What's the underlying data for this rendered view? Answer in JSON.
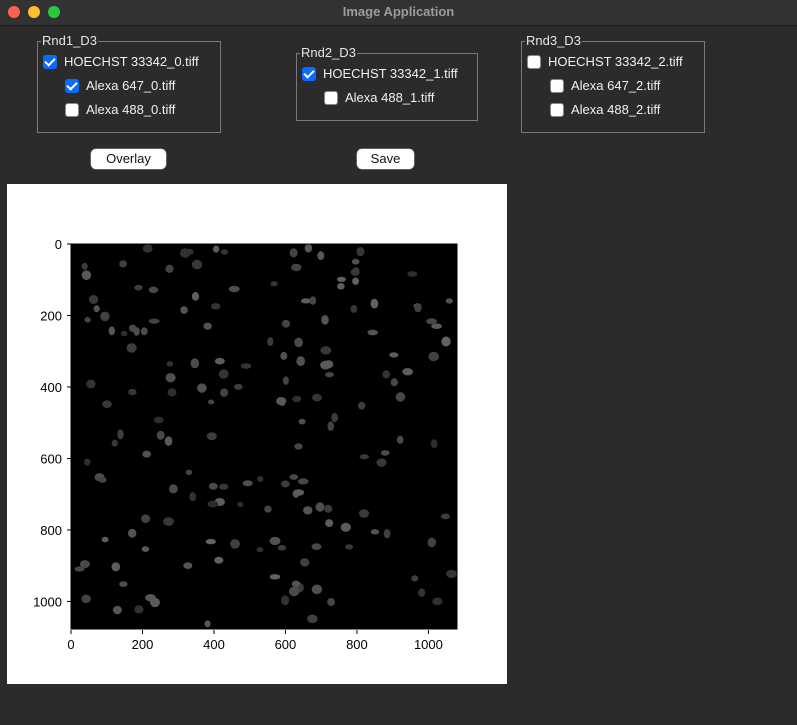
{
  "window": {
    "title": "Image Application"
  },
  "groups": [
    {
      "legend": "Rnd1_D3",
      "items": [
        {
          "label": "HOECHST 33342_0.tiff",
          "checked": true
        },
        {
          "label": "Alexa 647_0.tiff",
          "checked": true
        },
        {
          "label": "Alexa 488_0.tiff",
          "checked": false
        }
      ]
    },
    {
      "legend": "Rnd2_D3",
      "items": [
        {
          "label": "HOECHST 33342_1.tiff",
          "checked": true
        },
        {
          "label": "Alexa 488_1.tiff",
          "checked": false
        }
      ]
    },
    {
      "legend": "Rnd3_D3",
      "items": [
        {
          "label": "HOECHST 33342_2.tiff",
          "checked": false
        },
        {
          "label": "Alexa 647_2.tiff",
          "checked": false
        },
        {
          "label": "Alexa 488_2.tiff",
          "checked": false
        }
      ]
    }
  ],
  "buttons": {
    "overlay": "Overlay",
    "save": "Save"
  },
  "plot": {
    "x_ticks": [
      "0",
      "200",
      "400",
      "600",
      "800",
      "1000"
    ],
    "y_ticks": [
      "0",
      "200",
      "400",
      "600",
      "800",
      "1000"
    ]
  }
}
